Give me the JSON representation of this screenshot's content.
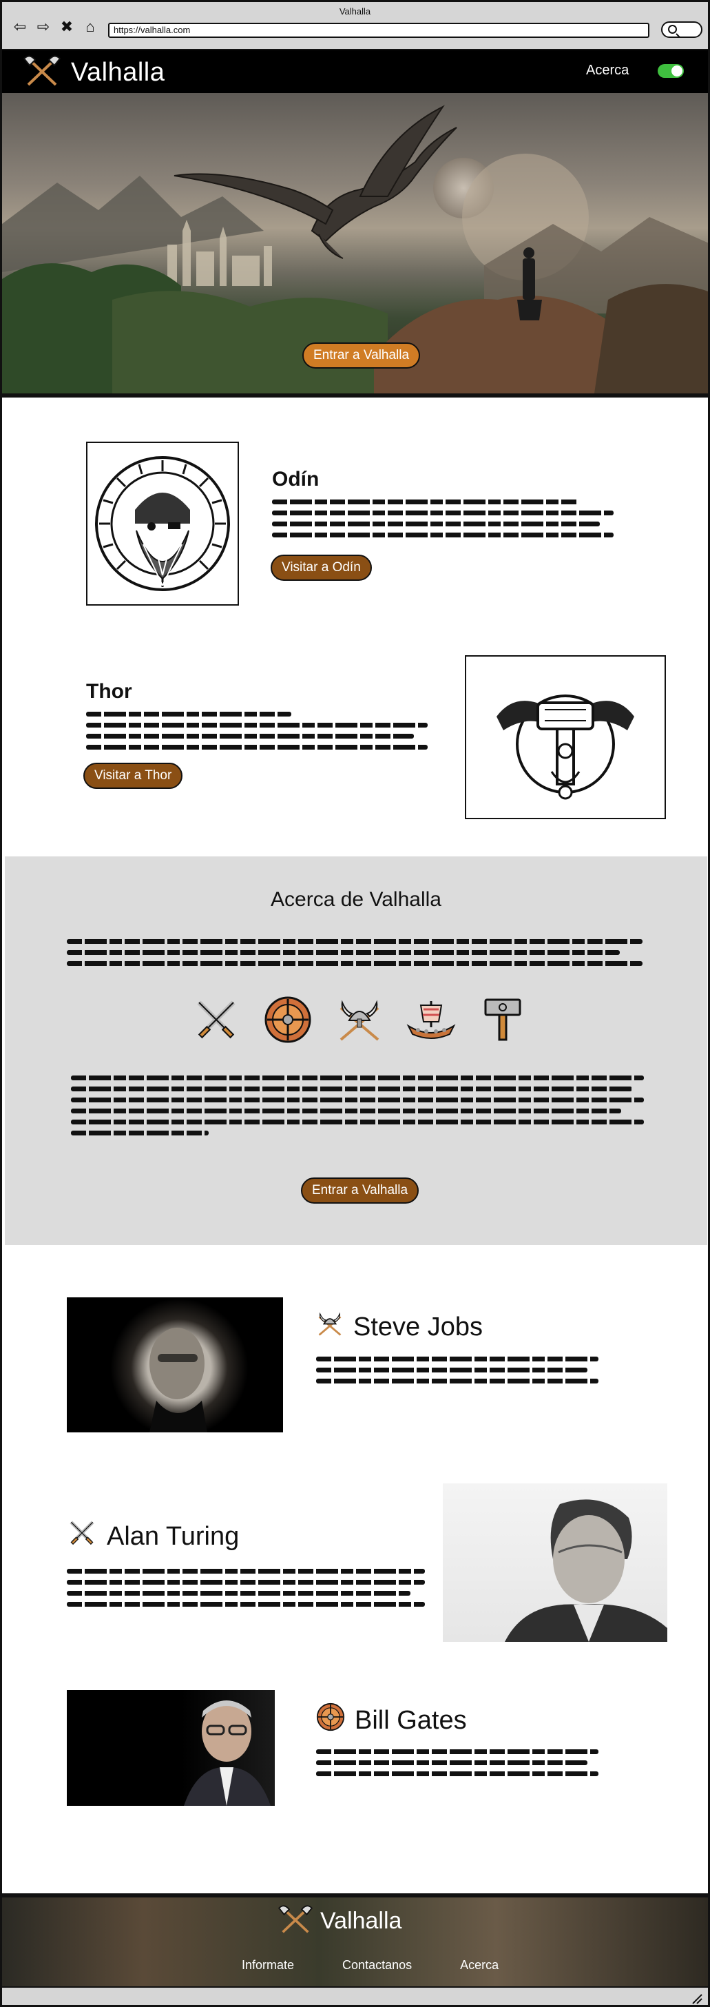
{
  "browser": {
    "window_title": "Valhalla",
    "url": "https://valhalla.com",
    "nav_icons": [
      "back-icon",
      "forward-icon",
      "close-icon",
      "home-icon"
    ]
  },
  "header": {
    "logo_text": "Valhalla",
    "nav_link": "Acerca",
    "toggle_on": true
  },
  "hero": {
    "cta_label": "Entrar a Valhalla"
  },
  "features": [
    {
      "title": "Odín",
      "cta_label": "Visitar a Odín",
      "icon": "odin-portrait-icon"
    },
    {
      "title": "Thor",
      "cta_label": "Visitar a Thor",
      "icon": "mjolnir-ravens-icon"
    }
  ],
  "about": {
    "title": "Acerca de Valhalla",
    "icons": [
      "crossed-swords-icon",
      "shield-icon",
      "viking-helmet-axes-icon",
      "viking-ship-icon",
      "hammer-icon"
    ],
    "cta_label": "Entrar a Valhalla"
  },
  "people": [
    {
      "name": "Steve Jobs",
      "icon": "viking-helmet-axes-icon"
    },
    {
      "name": "Alan Turing",
      "icon": "crossed-swords-icon"
    },
    {
      "name": "Bill Gates",
      "icon": "shield-icon"
    }
  ],
  "footer": {
    "logo_text": "Valhalla",
    "links": [
      "Informate",
      "Contactanos",
      "Acerca"
    ]
  },
  "colors": {
    "cta_brown": "#8a4f14",
    "cta_orange": "#d07c24",
    "toggle_green": "#3fbf3f",
    "about_bg": "#dcdcdc"
  }
}
